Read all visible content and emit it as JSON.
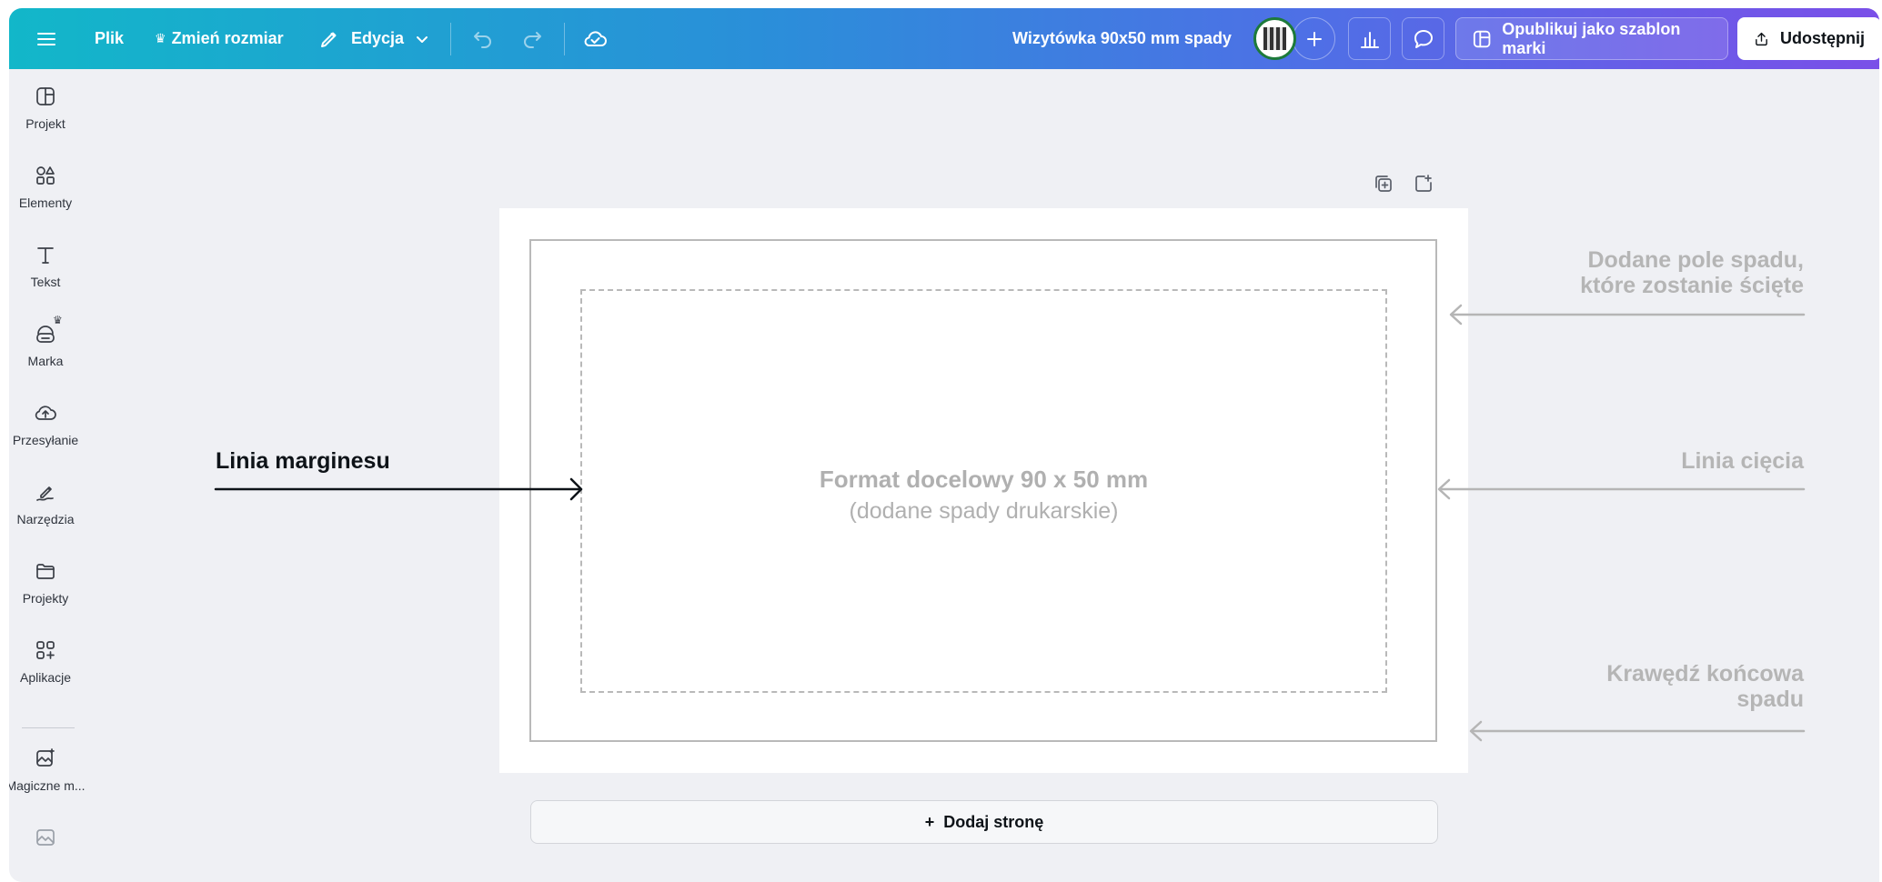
{
  "topbar": {
    "file_label": "Plik",
    "resize_label": "Zmień rozmiar",
    "edit_label": "Edycja",
    "doc_title": "Wizytówka 90x50 mm spady",
    "publish_label": "Opublikuj jako szablon marki",
    "share_label": "Udostępnij"
  },
  "sidebar": {
    "items": [
      {
        "label": "Projekt",
        "icon": "layout-icon"
      },
      {
        "label": "Elementy",
        "icon": "shapes-icon"
      },
      {
        "label": "Tekst",
        "icon": "text-icon"
      },
      {
        "label": "Marka",
        "icon": "brand-icon"
      },
      {
        "label": "Przesyłanie",
        "icon": "upload-cloud-icon"
      },
      {
        "label": "Narzędzia",
        "icon": "draw-tools-icon"
      },
      {
        "label": "Projekty",
        "icon": "folder-icon"
      },
      {
        "label": "Aplikacje",
        "icon": "apps-icon"
      },
      {
        "label": "Magiczne m...",
        "icon": "magic-media-icon"
      }
    ]
  },
  "canvas": {
    "format_title": "Format docelowy 90 x 50 mm",
    "format_subtitle": "(dodane spady drukarskie)",
    "margin_label": "Linia marginesu",
    "bleed_area_label_1": "Dodane pole spadu,",
    "bleed_area_label_2": "które zostanie ścięte",
    "cut_line_label": "Linia cięcia",
    "bleed_edge_label_1": "Krawędź końcowa",
    "bleed_edge_label_2": "spadu",
    "add_page_label": "Dodaj stronę"
  },
  "colors": {
    "accent_start": "#12b7c9",
    "accent_end": "#7a4fe8",
    "annotation_gray": "#b5b5b5"
  }
}
